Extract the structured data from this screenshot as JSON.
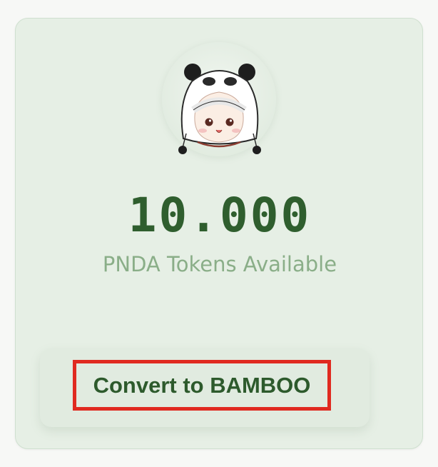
{
  "token_card": {
    "avatar_icon": "panda-hat-mascot-icon",
    "balance": "10.000",
    "label": "PNDA Tokens Available",
    "convert_button_label": "Convert to BAMBOO"
  },
  "colors": {
    "card_background": "#e6efe5",
    "balance_text": "#2f5e2e",
    "label_text": "#8aae88",
    "button_text": "#2d5a2c",
    "highlight_border": "#e02a20"
  }
}
